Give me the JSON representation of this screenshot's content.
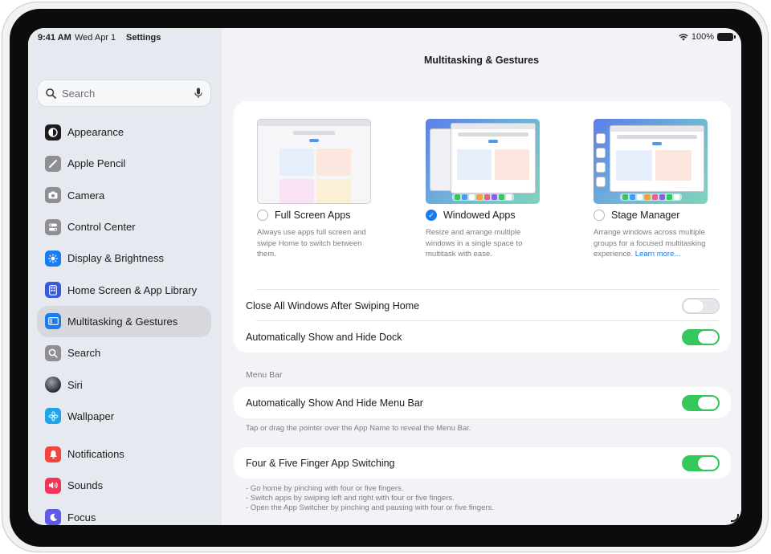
{
  "status_bar": {
    "time": "9:41 AM",
    "date": "Wed Apr 1",
    "app": "Settings",
    "battery": "100%"
  },
  "sidebar": {
    "search_placeholder": "Search",
    "items": [
      {
        "label": "Appearance",
        "icon": "appearance-icon",
        "color": "#1c1c1e"
      },
      {
        "label": "Apple Pencil",
        "icon": "pencil-icon",
        "color": "#8e8e93"
      },
      {
        "label": "Camera",
        "icon": "camera-icon",
        "color": "#8e8e93"
      },
      {
        "label": "Control Center",
        "icon": "control-center-icon",
        "color": "#8e8e93"
      },
      {
        "label": "Display & Brightness",
        "icon": "sun-icon",
        "color": "#1a7cf1"
      },
      {
        "label": "Home Screen & App Library",
        "icon": "home-screen-icon",
        "color": "#3a59d6"
      },
      {
        "label": "Multitasking & Gestures",
        "icon": "multitasking-icon",
        "color": "#1a7cf1",
        "active": true
      },
      {
        "label": "Search",
        "icon": "search-icon",
        "color": "#8e8e93"
      },
      {
        "label": "Siri",
        "icon": "siri-icon",
        "color": "#2b2b2f"
      },
      {
        "label": "Wallpaper",
        "icon": "wallpaper-icon",
        "color": "#1fa4e8"
      },
      {
        "label": "Notifications",
        "icon": "bell-icon",
        "color": "#f2453d"
      },
      {
        "label": "Sounds",
        "icon": "speaker-icon",
        "color": "#f0345a"
      },
      {
        "label": "Focus",
        "icon": "moon-icon",
        "color": "#5e5ce6"
      }
    ]
  },
  "main": {
    "title": "Multitasking & Gestures",
    "options": [
      {
        "label": "Full Screen Apps",
        "desc": "Always use apps full screen and swipe Home to switch between them.",
        "selected": false
      },
      {
        "label": "Windowed Apps",
        "desc": "Resize and arrange multiple windows in a single space to multitask with ease.",
        "selected": true
      },
      {
        "label": "Stage Manager",
        "desc": "Arrange windows across multiple groups for a focused multitasking experience.",
        "link": "Learn more...",
        "selected": false
      }
    ],
    "rows": {
      "close_all": {
        "label": "Close All Windows After Swiping Home",
        "on": false
      },
      "show_hide_dock": {
        "label": "Automatically Show and Hide Dock",
        "on": true
      },
      "menu_bar_header": "Menu Bar",
      "show_hide_menu_bar": {
        "label": "Automatically Show And Hide Menu Bar",
        "on": true
      },
      "menu_bar_note": "Tap or drag the pointer over the App Name to reveal the Menu Bar.",
      "four_five_finger": {
        "label": "Four & Five Finger App Switching",
        "on": true
      },
      "gesture_notes": [
        "- Go home by pinching with four or five fingers.",
        "- Switch apps by swiping left and right with four or five fingers.",
        "- Open the App Switcher by pinching and pausing with four or five fingers."
      ]
    }
  },
  "colors": {
    "accent": "#1a7cf1",
    "toggle_on": "#34c759",
    "sidebar_bg": "#e6e9ef"
  }
}
